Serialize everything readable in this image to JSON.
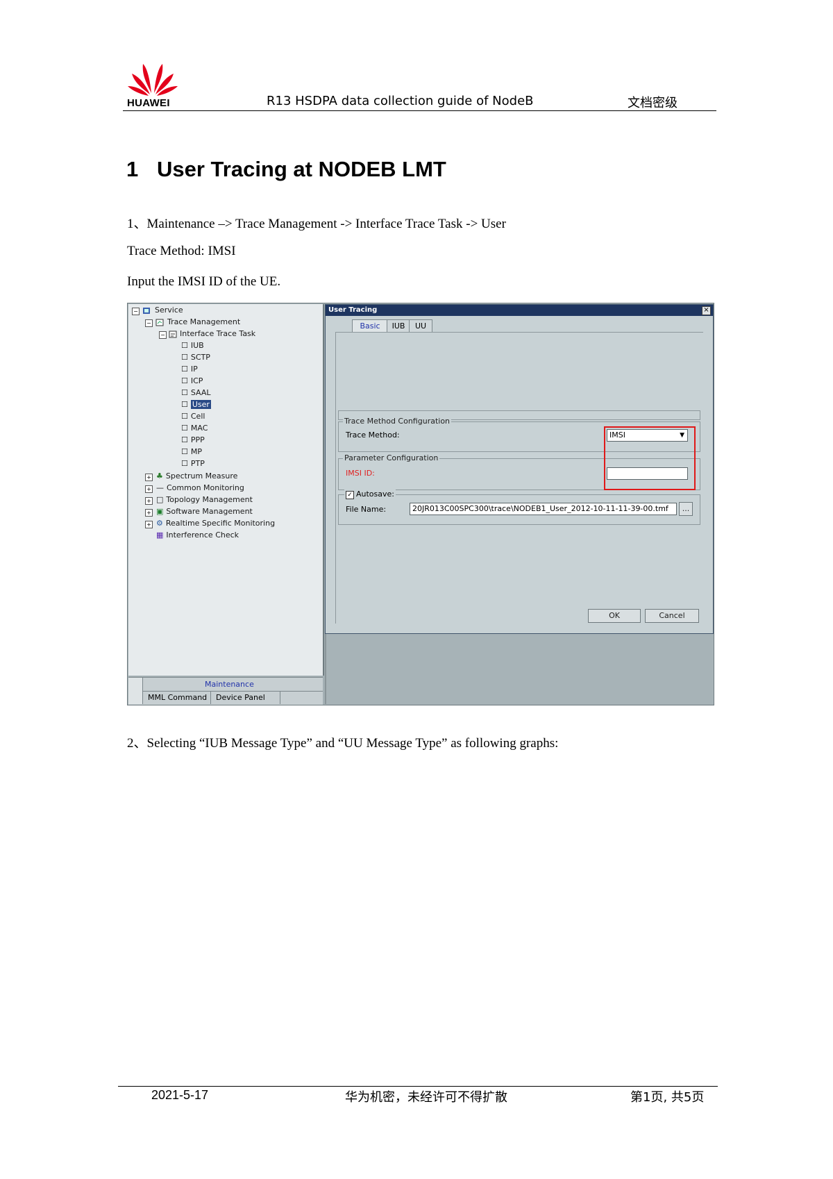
{
  "header": {
    "logo_text": "HUAWEI",
    "doc_title": "R13 HSDPA data collection guide of NodeB",
    "classification": "文档密级"
  },
  "section": {
    "number": "1",
    "title": "User Tracing at NODEB LMT"
  },
  "paragraphs": {
    "step1": "1、Maintenance –> Trace Management -> Interface Trace Task -> User",
    "method": "Trace Method: IMSI",
    "input": "Input the IMSI ID of the UE.",
    "step2": "2、Selecting “IUB Message Type”  and “UU Message Type” as following graphs:"
  },
  "screenshot": {
    "tree": {
      "root": "Service",
      "trace_mgmt": "Trace Management",
      "interface_task": "Interface Trace Task",
      "items": [
        "IUB",
        "SCTP",
        "IP",
        "ICP",
        "SAAL",
        "User",
        "Cell",
        "MAC",
        "PPP",
        "MP",
        "PTP"
      ],
      "others": [
        "Spectrum Measure",
        "Common Monitoring",
        "Topology Management",
        "Software Management",
        "Realtime Specific Monitoring",
        "Interference Check"
      ]
    },
    "bottom_tabs": {
      "maintenance": "Maintenance",
      "mml": "MML Command",
      "device": "Device Panel"
    },
    "dialog": {
      "title": "User Tracing",
      "close": "×",
      "tabs": [
        "Basic",
        "IUB",
        "UU"
      ],
      "trace_method_group": "Trace Method Configuration",
      "trace_method_label": "Trace Method:",
      "trace_method_value": "IMSI",
      "param_group": "Parameter Configuration",
      "param_label": "IMSI ID:",
      "autosave_label": "Autosave:",
      "file_name_label": "File Name:",
      "file_name_value": "20JR013C00SPC300\\trace\\NODEB1_User_2012-10-11-11-39-00.tmf",
      "browse": "...",
      "ok": "OK",
      "cancel": "Cancel"
    }
  },
  "footer": {
    "date": "2021-5-17",
    "confidential": "华为机密，未经许可不得扩散",
    "page": "第1页, 共5页"
  }
}
